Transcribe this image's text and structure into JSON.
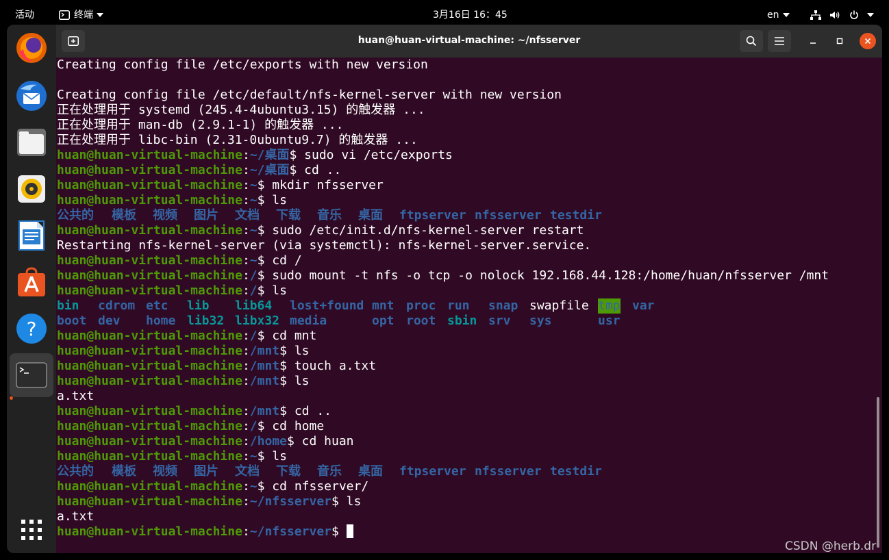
{
  "topbar": {
    "activities": "活动",
    "app_name": "终端",
    "datetime": "3月16日  16：45",
    "lang": "en"
  },
  "dock": {
    "items": [
      "firefox-icon",
      "thunderbird-icon",
      "files-icon",
      "rhythmbox-icon",
      "writer-icon",
      "software-icon",
      "help-icon",
      "terminal-icon",
      "show-apps-icon"
    ]
  },
  "window": {
    "title": "huan@huan-virtual-machine: ~/nfsserver"
  },
  "terminal": {
    "user": "huan@huan-virtual-machine",
    "lines": [
      "Creating config file /etc/exports with new version",
      "",
      "Creating config file /etc/default/nfs-kernel-server with new version",
      "正在处理用于 systemd (245.4-4ubuntu3.15) 的触发器 ...",
      "正在处理用于 man-db (2.9.1-1) 的触发器 ...",
      "正在处理用于 libc-bin (2.31-0ubuntu9.7) 的触发器 ..."
    ],
    "prompts": [
      {
        "path": "~/桌面",
        "cmd": " sudo vi /etc/exports"
      },
      {
        "path": "~/桌面",
        "cmd": " cd .."
      },
      {
        "path": "~",
        "cmd": " mkdir nfsserver"
      },
      {
        "path": "~",
        "cmd": " ls"
      },
      {
        "path": "~",
        "cmd": " sudo /etc/init.d/nfs-kernel-server restart"
      },
      {
        "path": "~",
        "cmd": " cd /"
      },
      {
        "path": "/",
        "cmd": " sudo mount -t nfs -o tcp -o nolock 192.168.44.128:/home/huan/nfsserver /mnt"
      },
      {
        "path": "/",
        "cmd": " ls"
      },
      {
        "path": "/",
        "cmd": " cd mnt"
      },
      {
        "path": "/mnt",
        "cmd": " ls"
      },
      {
        "path": "/mnt",
        "cmd": " touch a.txt"
      },
      {
        "path": "/mnt",
        "cmd": " ls"
      },
      {
        "path": "/mnt",
        "cmd": " cd .."
      },
      {
        "path": "/",
        "cmd": " cd home"
      },
      {
        "path": "/home",
        "cmd": " cd huan"
      },
      {
        "path": "~",
        "cmd": " ls"
      },
      {
        "path": "~",
        "cmd": " cd nfsserver/"
      },
      {
        "path": "~/nfsserver",
        "cmd": " ls"
      },
      {
        "path": "~/nfsserver",
        "cmd": " "
      }
    ],
    "home_listing": [
      "公共的",
      "模板",
      "视频",
      "图片",
      "文档",
      "下载",
      "音乐",
      "桌面",
      "ftpserver",
      "nfsserver",
      "testdir"
    ],
    "restart_output": "Restarting nfs-kernel-server (via systemctl): nfs-kernel-server.service.",
    "root_listing_row1": [
      "bin",
      "cdrom",
      "etc",
      "lib",
      "lib64",
      "lost+found",
      "mnt",
      "proc",
      "run",
      "snap",
      "swapfile",
      "tmp",
      "var"
    ],
    "root_listing_row2": [
      "boot",
      "dev",
      "home",
      "lib32",
      "libx32",
      "media",
      "opt",
      "root",
      "sbin",
      "srv",
      "sys",
      "usr"
    ],
    "file_a": "a.txt"
  },
  "watermark": "CSDN @herb.dr"
}
